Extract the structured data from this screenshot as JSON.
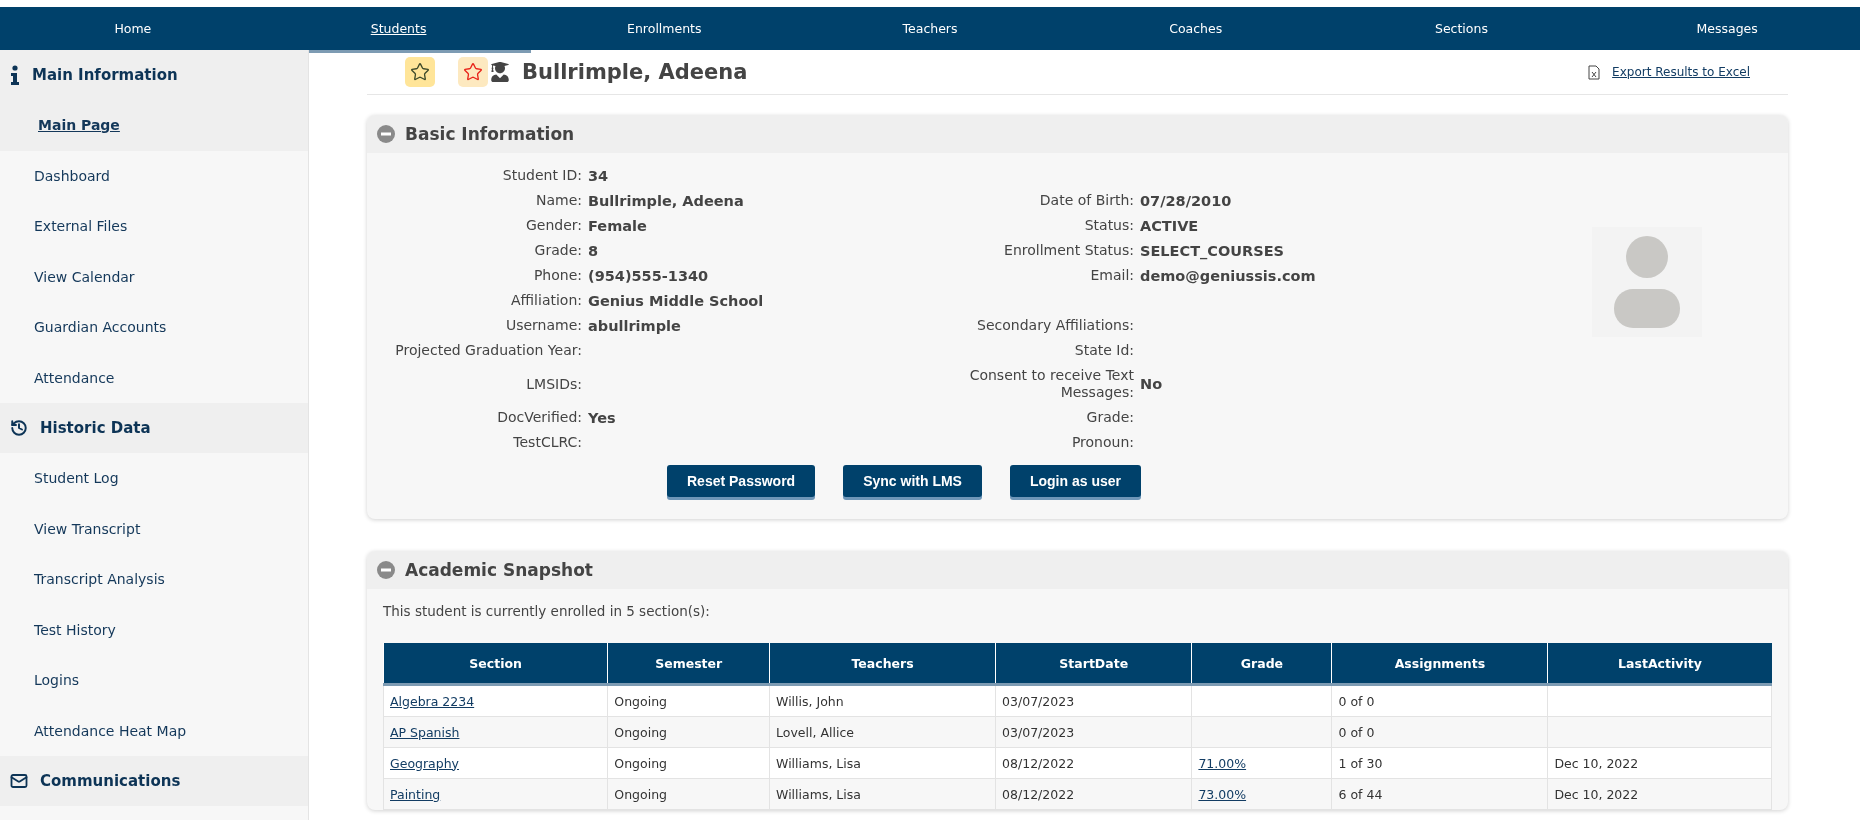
{
  "nav": [
    {
      "label": "Home",
      "selected": false
    },
    {
      "label": "Students",
      "selected": true
    },
    {
      "label": "Enrollments",
      "selected": false
    },
    {
      "label": "Teachers",
      "selected": false
    },
    {
      "label": "Coaches",
      "selected": false
    },
    {
      "label": "Sections",
      "selected": false
    },
    {
      "label": "Messages",
      "selected": false
    }
  ],
  "sidebar": [
    {
      "title": "Main Information",
      "kind": "info",
      "items": [
        {
          "label": "Main Page",
          "selected": true
        },
        {
          "label": "Dashboard",
          "selected": false
        },
        {
          "label": "External Files",
          "selected": false
        },
        {
          "label": "View Calendar",
          "selected": false
        },
        {
          "label": "Guardian Accounts",
          "selected": false
        },
        {
          "label": "Attendance",
          "selected": false
        }
      ]
    },
    {
      "title": "Historic Data",
      "kind": "history",
      "items": [
        {
          "label": "Student Log",
          "selected": false
        },
        {
          "label": "View Transcript",
          "selected": false
        },
        {
          "label": "Transcript Analysis",
          "selected": false
        },
        {
          "label": "Test History",
          "selected": false
        },
        {
          "label": "Logins",
          "selected": false
        },
        {
          "label": "Attendance Heat Map",
          "selected": false
        }
      ]
    },
    {
      "title": "Communications",
      "kind": "mail"
    }
  ],
  "header": {
    "student_name": "Bullrimple, Adeena",
    "export_link": "Export Results to Excel"
  },
  "basic_info": {
    "title": "Basic Information",
    "rows": [
      {
        "left": {
          "label": "Student ID:",
          "value": "34"
        }
      },
      {
        "left": {
          "label": "Name:",
          "value": "Bullrimple, Adeena"
        },
        "right": {
          "label": "Date of Birth:",
          "value": "07/28/2010"
        }
      },
      {
        "left": {
          "label": "Gender:",
          "value": "Female"
        },
        "right": {
          "label": "Status:",
          "value": "ACTIVE"
        }
      },
      {
        "left": {
          "label": "Grade:",
          "value": "8"
        },
        "right": {
          "label": "Enrollment Status:",
          "value": "SELECT_COURSES"
        }
      },
      {
        "left": {
          "label": "Phone:",
          "value": "(954)555-1340"
        },
        "right": {
          "label": "Email:",
          "value": "demo@geniussis.com"
        }
      },
      {
        "left": {
          "label": "Affiliation:",
          "value": "Genius Middle School"
        }
      },
      {
        "left": {
          "label": "Username:",
          "value": "abullrimple"
        },
        "right": {
          "label": "Secondary Affiliations:"
        }
      },
      {
        "left": {
          "label": "Projected Graduation Year:"
        },
        "right": {
          "label": "State Id:"
        }
      },
      {
        "left": {
          "label": "LMSIDs:"
        },
        "right": {
          "label": "Consent to receive Text Messages:",
          "value": "No"
        }
      },
      {
        "left": {
          "label": "DocVerified:",
          "value": "Yes"
        },
        "right": {
          "label": "Grade:"
        }
      },
      {
        "left": {
          "label": "TestCLRC:"
        },
        "right": {
          "label": "Pronoun:"
        }
      }
    ],
    "buttons": [
      "Reset Password",
      "Sync with LMS",
      "Login as user"
    ]
  },
  "academic_snapshot": {
    "title": "Academic Snapshot",
    "summary": "This student is currently enrolled in 5 section(s):",
    "table": {
      "columns": [
        "Section",
        "Semester",
        "Teachers",
        "StartDate",
        "Grade",
        "Assignments",
        "LastActivity"
      ],
      "rows": [
        [
          {
            "kind": "link",
            "text": "Algebra 2234"
          },
          {
            "kind": "text",
            "text": "Ongoing"
          },
          {
            "kind": "text",
            "text": "Willis, John"
          },
          {
            "kind": "text",
            "text": "03/07/2023"
          },
          {
            "kind": "empty"
          },
          {
            "kind": "text",
            "text": "0 of 0"
          },
          {
            "kind": "empty"
          }
        ],
        [
          {
            "kind": "link",
            "text": "AP Spanish"
          },
          {
            "kind": "text",
            "text": "Ongoing"
          },
          {
            "kind": "text",
            "text": "Lovell, Allice"
          },
          {
            "kind": "text",
            "text": "03/07/2023"
          },
          {
            "kind": "empty"
          },
          {
            "kind": "text",
            "text": "0 of 0"
          },
          {
            "kind": "empty"
          }
        ],
        [
          {
            "kind": "link",
            "text": "Geography"
          },
          {
            "kind": "text",
            "text": "Ongoing"
          },
          {
            "kind": "text",
            "text": "Williams, Lisa"
          },
          {
            "kind": "text",
            "text": "08/12/2022"
          },
          {
            "kind": "link",
            "text": "71.00%"
          },
          {
            "kind": "text",
            "text": "1 of 30"
          },
          {
            "kind": "text",
            "text": "Dec 10, 2022"
          }
        ],
        [
          {
            "kind": "link",
            "text": "Painting"
          },
          {
            "kind": "text",
            "text": "Ongoing"
          },
          {
            "kind": "text",
            "text": "Williams, Lisa"
          },
          {
            "kind": "text",
            "text": "08/12/2022"
          },
          {
            "kind": "link",
            "text": "73.00%"
          },
          {
            "kind": "text",
            "text": "6 of 44"
          },
          {
            "kind": "text",
            "text": "Dec 10, 2022"
          }
        ]
      ]
    }
  }
}
